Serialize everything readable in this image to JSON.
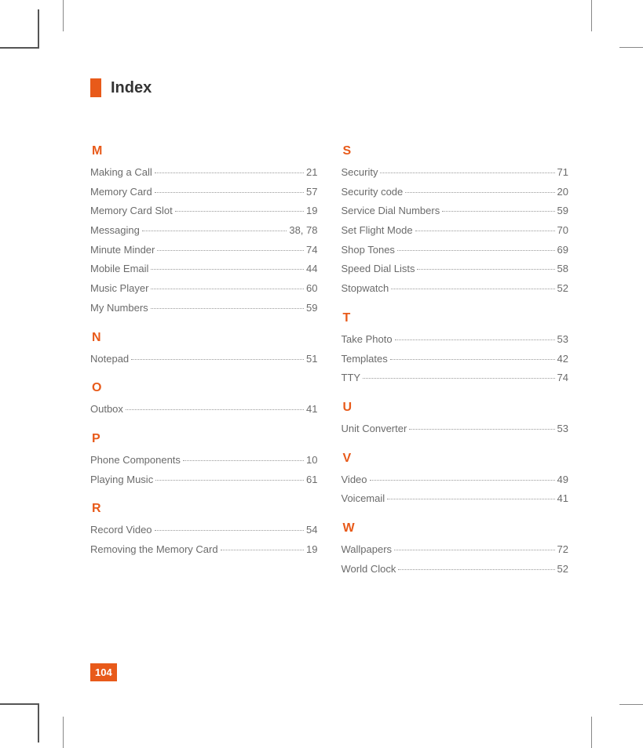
{
  "header": {
    "title": "Index"
  },
  "page_number": "104",
  "sections_left": [
    {
      "letter": "M",
      "entries": [
        {
          "label": "Making a Call",
          "page": "21"
        },
        {
          "label": "Memory Card",
          "page": "57"
        },
        {
          "label": "Memory Card Slot",
          "page": "19"
        },
        {
          "label": "Messaging",
          "page": "38, 78"
        },
        {
          "label": "Minute Minder",
          "page": "74"
        },
        {
          "label": "Mobile Email",
          "page": "44"
        },
        {
          "label": "Music Player",
          "page": "60"
        },
        {
          "label": "My Numbers",
          "page": "59"
        }
      ]
    },
    {
      "letter": "N",
      "entries": [
        {
          "label": "Notepad",
          "page": "51"
        }
      ]
    },
    {
      "letter": "O",
      "entries": [
        {
          "label": "Outbox",
          "page": "41"
        }
      ]
    },
    {
      "letter": "P",
      "entries": [
        {
          "label": "Phone Components",
          "page": "10"
        },
        {
          "label": "Playing Music",
          "page": "61"
        }
      ]
    },
    {
      "letter": "R",
      "entries": [
        {
          "label": "Record Video",
          "page": "54"
        },
        {
          "label": "Removing the Memory Card",
          "page": "19"
        }
      ]
    }
  ],
  "sections_right": [
    {
      "letter": "S",
      "entries": [
        {
          "label": "Security",
          "page": "71"
        },
        {
          "label": "Security code",
          "page": "20"
        },
        {
          "label": "Service Dial Numbers",
          "page": "59"
        },
        {
          "label": "Set Flight Mode",
          "page": "70"
        },
        {
          "label": "Shop Tones",
          "page": "69"
        },
        {
          "label": "Speed Dial Lists",
          "page": "58"
        },
        {
          "label": "Stopwatch",
          "page": "52"
        }
      ]
    },
    {
      "letter": "T",
      "entries": [
        {
          "label": "Take Photo",
          "page": "53"
        },
        {
          "label": "Templates",
          "page": "42"
        },
        {
          "label": "TTY",
          "page": "74"
        }
      ]
    },
    {
      "letter": "U",
      "entries": [
        {
          "label": "Unit Converter",
          "page": "53"
        }
      ]
    },
    {
      "letter": "V",
      "entries": [
        {
          "label": "Video",
          "page": "49"
        },
        {
          "label": "Voicemail",
          "page": "41"
        }
      ]
    },
    {
      "letter": "W",
      "entries": [
        {
          "label": "Wallpapers",
          "page": "72"
        },
        {
          "label": "World Clock",
          "page": "52"
        }
      ]
    }
  ]
}
